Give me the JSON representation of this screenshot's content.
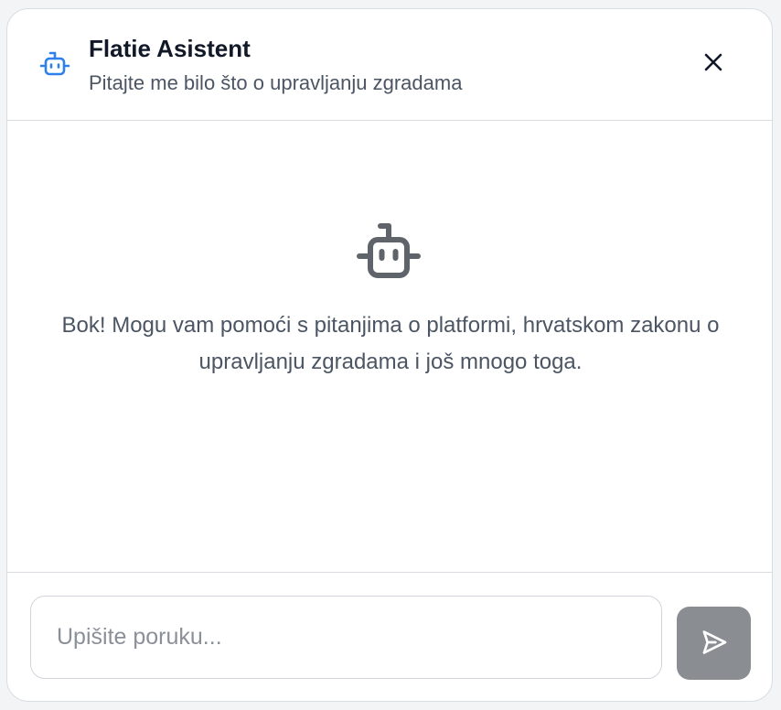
{
  "header": {
    "title": "Flatie Asistent",
    "subtitle": "Pitajte me bilo što o upravljanju zgradama",
    "icon": "bot-icon",
    "icon_color": "#2f80ed",
    "close_icon": "close-icon"
  },
  "welcome": {
    "icon": "bot-icon",
    "icon_color": "#5f636a",
    "text": "Bok! Mogu vam pomoći s pitanjima o platformi, hrvatskom zakonu o upravljanju zgradama i još mnogo toga."
  },
  "composer": {
    "placeholder": "Upišite poruku...",
    "value": "",
    "send_icon": "send-icon",
    "send_button_color": "#8a8d92"
  }
}
